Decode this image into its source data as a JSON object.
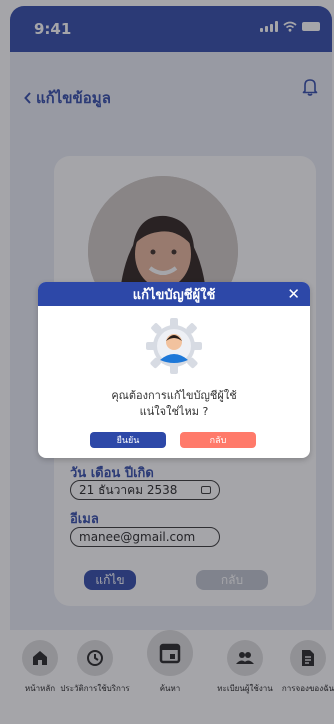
{
  "status": {
    "time": "9:41"
  },
  "header": {
    "title": "แก้ไขข้อมูล"
  },
  "form": {
    "birthdate_label": "วัน เดือน ปีเกิด",
    "birthdate_value": "21 ธันวาคม 2538",
    "email_label": "อีเมล",
    "email_value": "manee@gmail.com",
    "edit_label": "แก้ไข",
    "back_label": "กลับ"
  },
  "nav": {
    "items": [
      {
        "label": "หน้าหลัก",
        "icon": "home-icon"
      },
      {
        "label": "ประวัติการใช้บริการ",
        "icon": "history-icon"
      },
      {
        "label": "ค้นหา",
        "icon": "calendar-icon"
      },
      {
        "label": "ทะเบียนผู้ใช้งาน",
        "icon": "users-icon"
      },
      {
        "label": "การจองของฉัน",
        "icon": "document-icon"
      }
    ]
  },
  "modal": {
    "title": "แก้ไขบัญชีผู้ใช้",
    "line1": "คุณต้องการแก้ไขบัญชีผู้ใช้",
    "line2": "แน่ใจใช่ไหม ?",
    "confirm_label": "ยืนยัน",
    "cancel_label": "กลับ"
  },
  "colors": {
    "primary": "#2d48a8",
    "danger": "#ff7a6a",
    "muted": "#bfc4cf"
  }
}
